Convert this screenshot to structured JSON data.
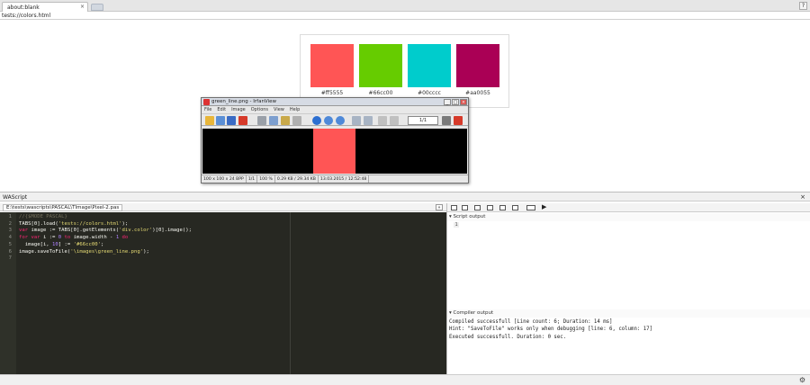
{
  "browser": {
    "tab_title": "about:blank",
    "tab_close": "×",
    "help": "?",
    "address": "tests://colors.html"
  },
  "swatches": [
    {
      "label": "#ff5555",
      "color": "#ff5555"
    },
    {
      "label": "#66cc00",
      "color": "#66cc00"
    },
    {
      "label": "#00cccc",
      "color": "#00cccc"
    },
    {
      "label": "#aa0055",
      "color": "#aa0055"
    }
  ],
  "irfanview": {
    "title": "green_line.png - IrfanView",
    "menu": [
      "File",
      "Edit",
      "Image",
      "Options",
      "View",
      "Help"
    ],
    "page": "1/1",
    "status": [
      "100 x 100 x 24 BPP",
      "1/1",
      "100 %",
      "0.29 KB / 29.34 KB",
      "13.03.2015 / 12:52:48"
    ],
    "image_color": "#ff5555"
  },
  "wascript": {
    "title": "WAScript",
    "close": "×",
    "file_path": "E:\\tests\\wascripts\\PASCAL\\TImage\\Pixel-2.pas",
    "code_lines": [
      {
        "n": "1",
        "tokens": [
          {
            "t": "//{$MODE PASCAL}",
            "c": "cm"
          }
        ]
      },
      {
        "n": "2",
        "tokens": [
          {
            "t": "TABS[0].load(",
            "c": ""
          },
          {
            "t": "'tests://colors.html'",
            "c": "st"
          },
          {
            "t": ");",
            "c": ""
          }
        ]
      },
      {
        "n": "3",
        "tokens": [
          {
            "t": "var",
            "c": "kw"
          },
          {
            "t": " image := TABS[0].getElements(",
            "c": ""
          },
          {
            "t": "'div.color'",
            "c": "st"
          },
          {
            "t": ")[0].image();",
            "c": ""
          }
        ]
      },
      {
        "n": "4",
        "tokens": [
          {
            "t": "for var",
            "c": "kw"
          },
          {
            "t": " i := ",
            "c": ""
          },
          {
            "t": "0",
            "c": "nu"
          },
          {
            "t": " to",
            "c": "kw"
          },
          {
            "t": " image.width - ",
            "c": ""
          },
          {
            "t": "1",
            "c": "nu"
          },
          {
            "t": " do",
            "c": "kw"
          }
        ]
      },
      {
        "n": "5",
        "tokens": [
          {
            "t": "  image[i, ",
            "c": ""
          },
          {
            "t": "10",
            "c": "nu"
          },
          {
            "t": "] := ",
            "c": ""
          },
          {
            "t": "'#66cc00'",
            "c": "st"
          },
          {
            "t": ";",
            "c": ""
          }
        ]
      },
      {
        "n": "6",
        "tokens": [
          {
            "t": "image.saveToFile(",
            "c": ""
          },
          {
            "t": "'\\images\\green_line.png'",
            "c": "st"
          },
          {
            "t": ");",
            "c": ""
          }
        ]
      },
      {
        "n": "7",
        "tokens": []
      }
    ],
    "script_output_label": "Script output",
    "script_output_line": "1",
    "compiler_output_label": "Compiler output",
    "compiler_lines": [
      "Compiled successfull [Line count: 6; Duration: 14 ms]",
      "Hint: \"SaveToFile\" works only when debugging [line: 6, column: 17]",
      "Executed successfull. Duration: 0 sec."
    ],
    "run_glyph": "▶",
    "gear_glyph": "⚙"
  }
}
